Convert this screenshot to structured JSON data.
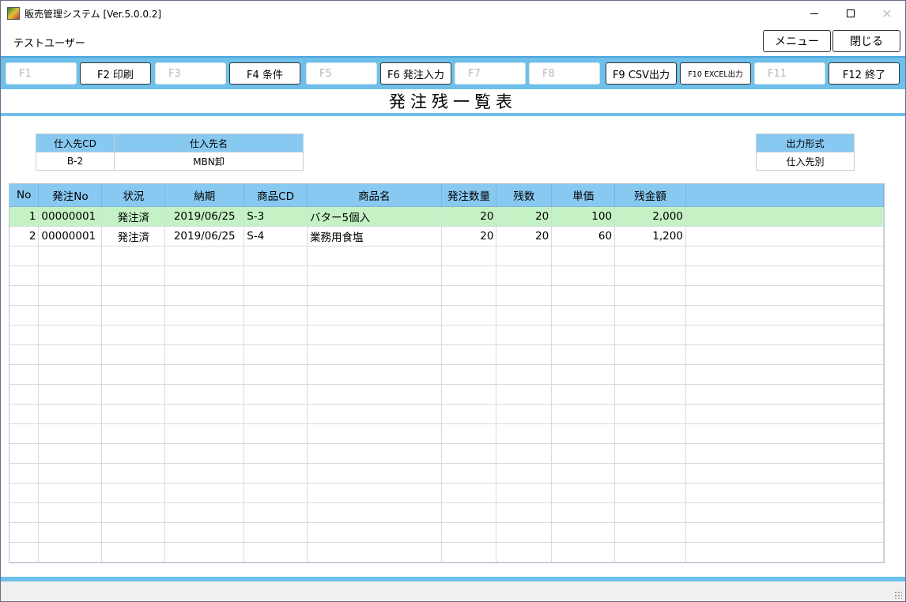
{
  "window": {
    "title": "販売管理システム [Ver.5.0.0.2]",
    "minimize": "—",
    "close": "✕"
  },
  "header": {
    "user": "テストユーザー",
    "menu_label": "メニュー",
    "close_label": "閉じる"
  },
  "fkeys": [
    {
      "label": "F1",
      "enabled": false
    },
    {
      "label": "F2 印刷",
      "enabled": true
    },
    {
      "label": "F3",
      "enabled": false
    },
    {
      "label": "F4 条件",
      "enabled": true
    },
    {
      "label": "F5",
      "enabled": false
    },
    {
      "label": "F6 発注入力",
      "enabled": true
    },
    {
      "label": "F7",
      "enabled": false
    },
    {
      "label": "F8",
      "enabled": false
    },
    {
      "label": "F9 CSV出力",
      "enabled": true
    },
    {
      "label": "F10 EXCEL出力",
      "enabled": true
    },
    {
      "label": "F11",
      "enabled": false
    },
    {
      "label": "F12 終了",
      "enabled": true
    }
  ],
  "page_title": "発注残一覧表",
  "supplier": {
    "cd_label": "仕入先CD",
    "name_label": "仕入先名",
    "cd": "B-2",
    "name": "MBN卸"
  },
  "output_format": {
    "label": "出力形式",
    "value": "仕入先別"
  },
  "grid": {
    "columns": [
      "No",
      "発注No",
      "状況",
      "納期",
      "商品CD",
      "商品名",
      "発注数量",
      "残数",
      "単価",
      "残金額"
    ],
    "rows": [
      [
        "1",
        "00000001",
        "発注済",
        "2019/06/25",
        "S-3",
        "バター5個入",
        "20",
        "20",
        "100",
        "2,000"
      ],
      [
        "2",
        "00000001",
        "発注済",
        "2019/06/25",
        "S-4",
        "業務用食塩",
        "20",
        "20",
        "60",
        "1,200"
      ]
    ],
    "selected_row": 0,
    "empty_rows": 16
  },
  "colors": {
    "accent": "#6ec0ea",
    "header": "#88c9f2",
    "selected": "#c4f2c4"
  }
}
